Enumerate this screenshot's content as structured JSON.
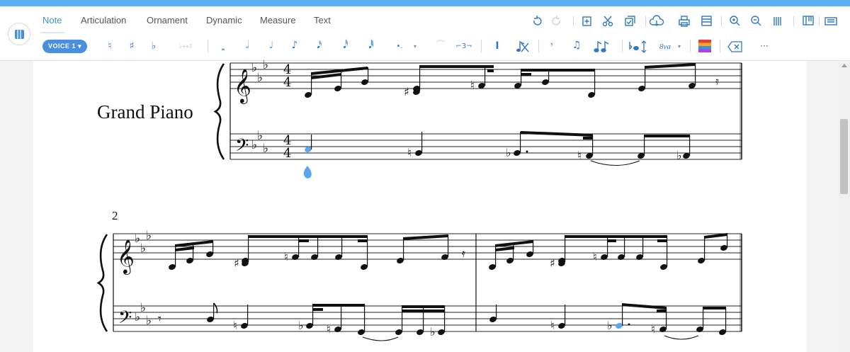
{
  "tabs": [
    {
      "label": "Note",
      "active": true
    },
    {
      "label": "Articulation"
    },
    {
      "label": "Ornament"
    },
    {
      "label": "Dynamic"
    },
    {
      "label": "Measure"
    },
    {
      "label": "Text"
    }
  ],
  "voice": {
    "label": "VOICE 1 ▾"
  },
  "note_toolbar": {
    "natural": "♮",
    "sharp": "♯",
    "flat": "♭",
    "enharmonic": "♭↔♯",
    "whole": "𝅝",
    "half": "𝅗𝅥",
    "quarter": "♩",
    "eighth": "♪",
    "sixteenth": "𝅘𝅥𝅯",
    "thirtysecond": "𝅘𝅥𝅰",
    "sixtyfourth": "𝅘𝅥𝅱",
    "dot": "•.",
    "dot_menu": "▾",
    "tie": "⌒",
    "tuplet": "⌐3¬",
    "cursor": "I",
    "grace_add": "𝄾",
    "beam": "♫",
    "octave": "8va",
    "octave_menu": "▾",
    "more": "···"
  },
  "score": {
    "instrument": "Grand Piano",
    "measure_number": "2"
  },
  "colors": {
    "accent": "#3d8fe0",
    "selected_note": "#5aa6f3",
    "voice_pill": "#4a8ee0"
  }
}
